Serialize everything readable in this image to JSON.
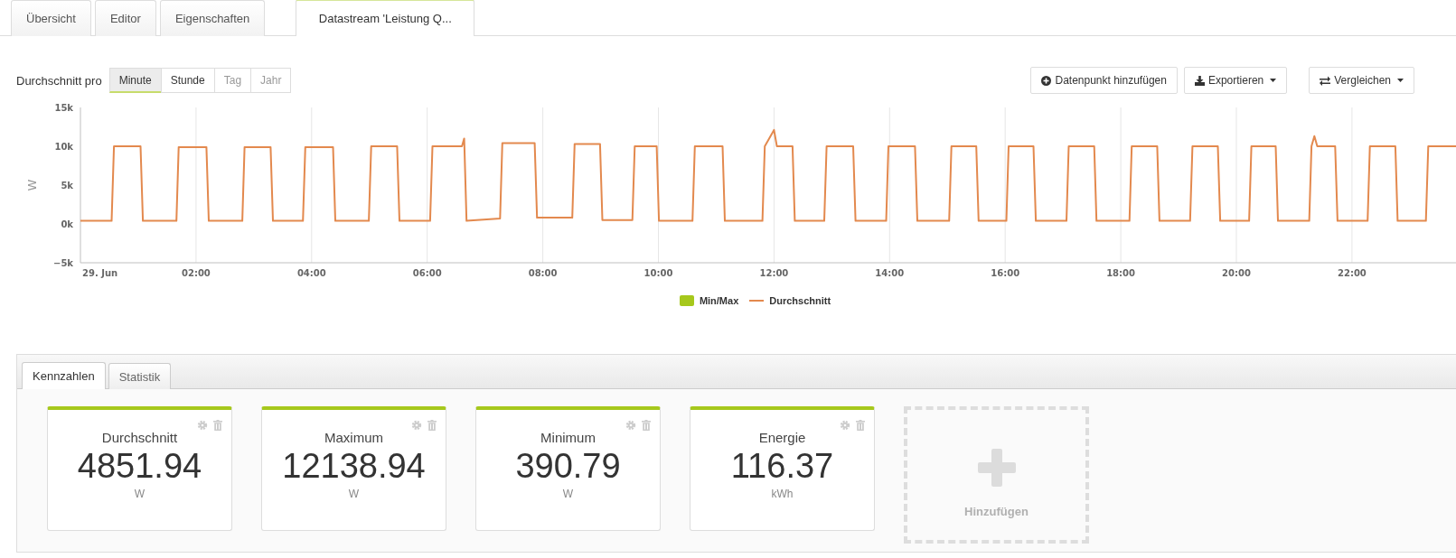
{
  "tabs": [
    {
      "label": "Übersicht",
      "selected": false
    },
    {
      "label": "Editor",
      "selected": false
    },
    {
      "label": "Eigenschaften",
      "selected": false
    },
    {
      "label": "Datastream 'Leistung Q...",
      "selected": true
    }
  ],
  "toolbar": {
    "label": "Durchschnitt pro",
    "intervals": [
      {
        "label": "Minute",
        "selected": true,
        "disabled": false
      },
      {
        "label": "Stunde",
        "selected": false,
        "disabled": false
      },
      {
        "label": "Tag",
        "selected": false,
        "disabled": true
      },
      {
        "label": "Jahr",
        "selected": false,
        "disabled": true
      }
    ],
    "actions": [
      {
        "label": "Datenpunkt hinzufügen",
        "kind": "add",
        "dropdown": false
      },
      {
        "label": "Exportieren",
        "kind": "export",
        "dropdown": true
      },
      {
        "label": "Vergleichen",
        "kind": "compare",
        "dropdown": true
      }
    ]
  },
  "chart": {
    "chart_data": {
      "type": "line",
      "grid": true,
      "ylabel": "W",
      "xlim": [
        0,
        23.8
      ],
      "ylim": [
        -5000,
        15000
      ],
      "yticks": [
        {
          "value": -5000,
          "label": "−5k"
        },
        {
          "value": 0,
          "label": "0k"
        },
        {
          "value": 5000,
          "label": "5k"
        },
        {
          "value": 10000,
          "label": "10k"
        },
        {
          "value": 15000,
          "label": "15k"
        }
      ],
      "xticks": [
        {
          "value": 0,
          "label": "29. Jun"
        },
        {
          "value": 2,
          "label": "02:00"
        },
        {
          "value": 4,
          "label": "04:00"
        },
        {
          "value": 6,
          "label": "06:00"
        },
        {
          "value": 8,
          "label": "08:00"
        },
        {
          "value": 10,
          "label": "10:00"
        },
        {
          "value": 12,
          "label": "12:00"
        },
        {
          "value": 14,
          "label": "14:00"
        },
        {
          "value": 16,
          "label": "16:00"
        },
        {
          "value": 18,
          "label": "18:00"
        },
        {
          "value": 20,
          "label": "20:00"
        },
        {
          "value": 22,
          "label": "22:00"
        }
      ],
      "x": [
        0,
        0.54,
        0.58,
        1.04,
        1.08,
        1.66,
        1.7,
        2.18,
        2.22,
        2.8,
        2.84,
        3.29,
        3.33,
        3.85,
        3.89,
        4.37,
        4.41,
        4.99,
        5.03,
        5.48,
        5.52,
        6.05,
        6.09,
        6.6,
        6.64,
        6.68,
        7.26,
        7.3,
        7.86,
        7.9,
        8.51,
        8.55,
        8.99,
        9.03,
        9.55,
        9.59,
        9.97,
        10.01,
        10.59,
        10.63,
        11.11,
        11.15,
        11.8,
        11.84,
        12,
        12.05,
        12.32,
        12.36,
        12.87,
        12.91,
        13.37,
        13.41,
        13.94,
        13.98,
        14.44,
        14.48,
        15.03,
        15.07,
        15.5,
        15.54,
        16.02,
        16.06,
        16.49,
        16.53,
        17.06,
        17.1,
        17.54,
        17.58,
        18.15,
        18.19,
        18.63,
        18.67,
        19.2,
        19.24,
        19.68,
        19.72,
        20.22,
        20.26,
        20.68,
        20.72,
        21.26,
        21.3,
        21.35,
        21.4,
        21.71,
        21.75,
        22.27,
        22.31,
        22.75,
        22.79,
        23.28,
        23.32,
        23.8
      ],
      "series": [
        {
          "name": "Durchschnitt",
          "color": "#e3894e",
          "values": [
            400,
            400,
            10000,
            10000,
            400,
            400,
            9900,
            9900,
            400,
            400,
            9900,
            9900,
            400,
            400,
            9900,
            9900,
            400,
            400,
            10000,
            10000,
            400,
            400,
            10000,
            10000,
            11000,
            400,
            700,
            10400,
            10400,
            800,
            800,
            10300,
            10300,
            500,
            500,
            10000,
            10000,
            400,
            400,
            10000,
            10000,
            400,
            400,
            10000,
            12100,
            10000,
            10000,
            400,
            400,
            10000,
            10000,
            400,
            400,
            10000,
            10000,
            400,
            400,
            10000,
            10000,
            400,
            400,
            10000,
            10000,
            400,
            400,
            10000,
            10000,
            400,
            400,
            10000,
            10000,
            400,
            400,
            10000,
            10000,
            400,
            400,
            10000,
            10000,
            400,
            400,
            10000,
            11300,
            10000,
            10000,
            400,
            400,
            10000,
            10000,
            400,
            400,
            10000,
            10000
          ]
        }
      ]
    },
    "legend": [
      {
        "label": "Min/Max",
        "kind": "box",
        "color": "#a6c81c"
      }
    ]
  },
  "panel": {
    "tabs": [
      {
        "label": "Kennzahlen",
        "selected": true
      },
      {
        "label": "Statistik",
        "selected": false
      }
    ],
    "cards": [
      {
        "title": "Durchschnitt",
        "value": "4851.94",
        "unit": "W"
      },
      {
        "title": "Maximum",
        "value": "12138.94",
        "unit": "W"
      },
      {
        "title": "Minimum",
        "value": "390.79",
        "unit": "W"
      },
      {
        "title": "Energie",
        "value": "116.37",
        "unit": "kWh"
      }
    ],
    "add_card": {
      "label": "Hinzufügen"
    }
  }
}
